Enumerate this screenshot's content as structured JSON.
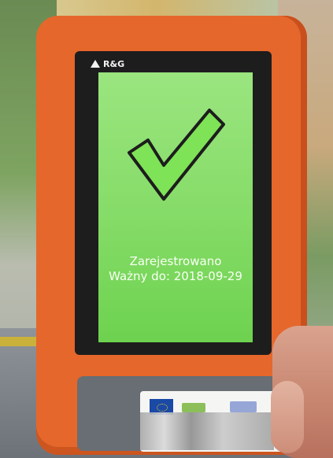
{
  "device": {
    "brand": "R&G",
    "icons": {
      "brand_mark": "triangle-logo-icon",
      "status": "checkmark-icon"
    }
  },
  "screen": {
    "status": "Zarejestrowano",
    "valid_until": "Ważny do: 2018-09-29"
  },
  "colors": {
    "device_body": "#e5672b",
    "screen_green": "#86dc68",
    "check_fill": "#7ee356",
    "check_outline": "#1d1d1d"
  }
}
